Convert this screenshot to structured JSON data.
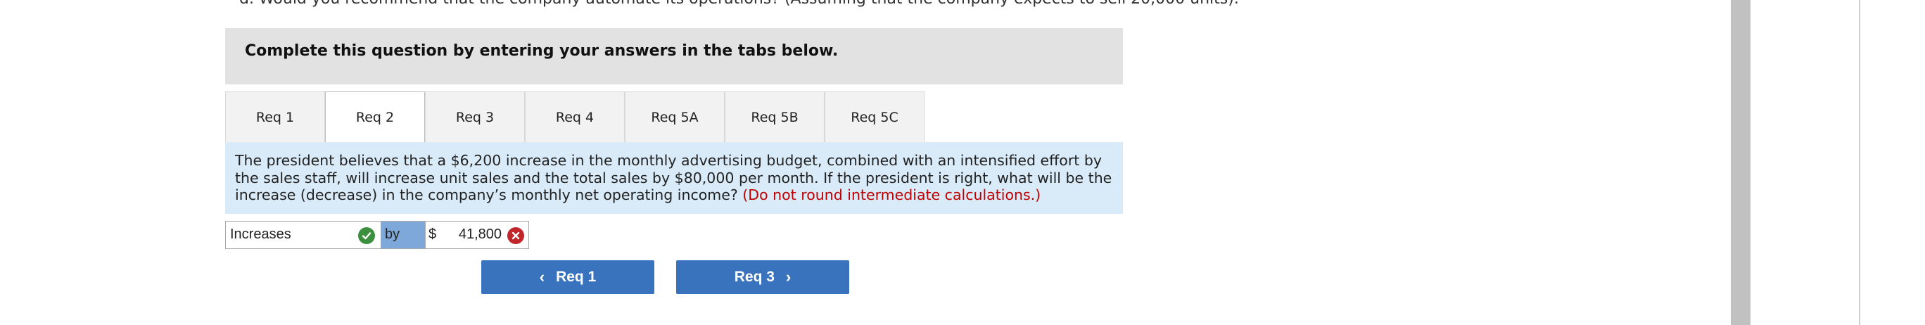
{
  "header_clip": "d. Would you recommend that the company automate its operations? (Assuming that the company expects to sell 20,000 units).",
  "instruction": "Complete this question by entering your answers in the tabs below.",
  "tabs": [
    {
      "label": "Req 1",
      "active": false
    },
    {
      "label": "Req 2",
      "active": true
    },
    {
      "label": "Req 3",
      "active": false
    },
    {
      "label": "Req 4",
      "active": false
    },
    {
      "label": "Req 5A",
      "active": false
    },
    {
      "label": "Req 5B",
      "active": false
    },
    {
      "label": "Req 5C",
      "active": false
    }
  ],
  "prompt": {
    "text": "The president believes that a $6,200 increase in the monthly advertising budget, combined with an intensified effort by the sales staff, will increase unit sales and the total sales by $80,000 per month. If the president is right, what will be the increase (decrease) in the company’s monthly net operating income?",
    "note": "(Do not round intermediate calculations.)"
  },
  "answer": {
    "direction_value": "Increases",
    "direction_status": "correct",
    "by_label": "by",
    "currency": "$",
    "amount_value": "41,800",
    "amount_status": "incorrect"
  },
  "navigation": {
    "prev_label": "Req 1",
    "next_label": "Req 3"
  }
}
